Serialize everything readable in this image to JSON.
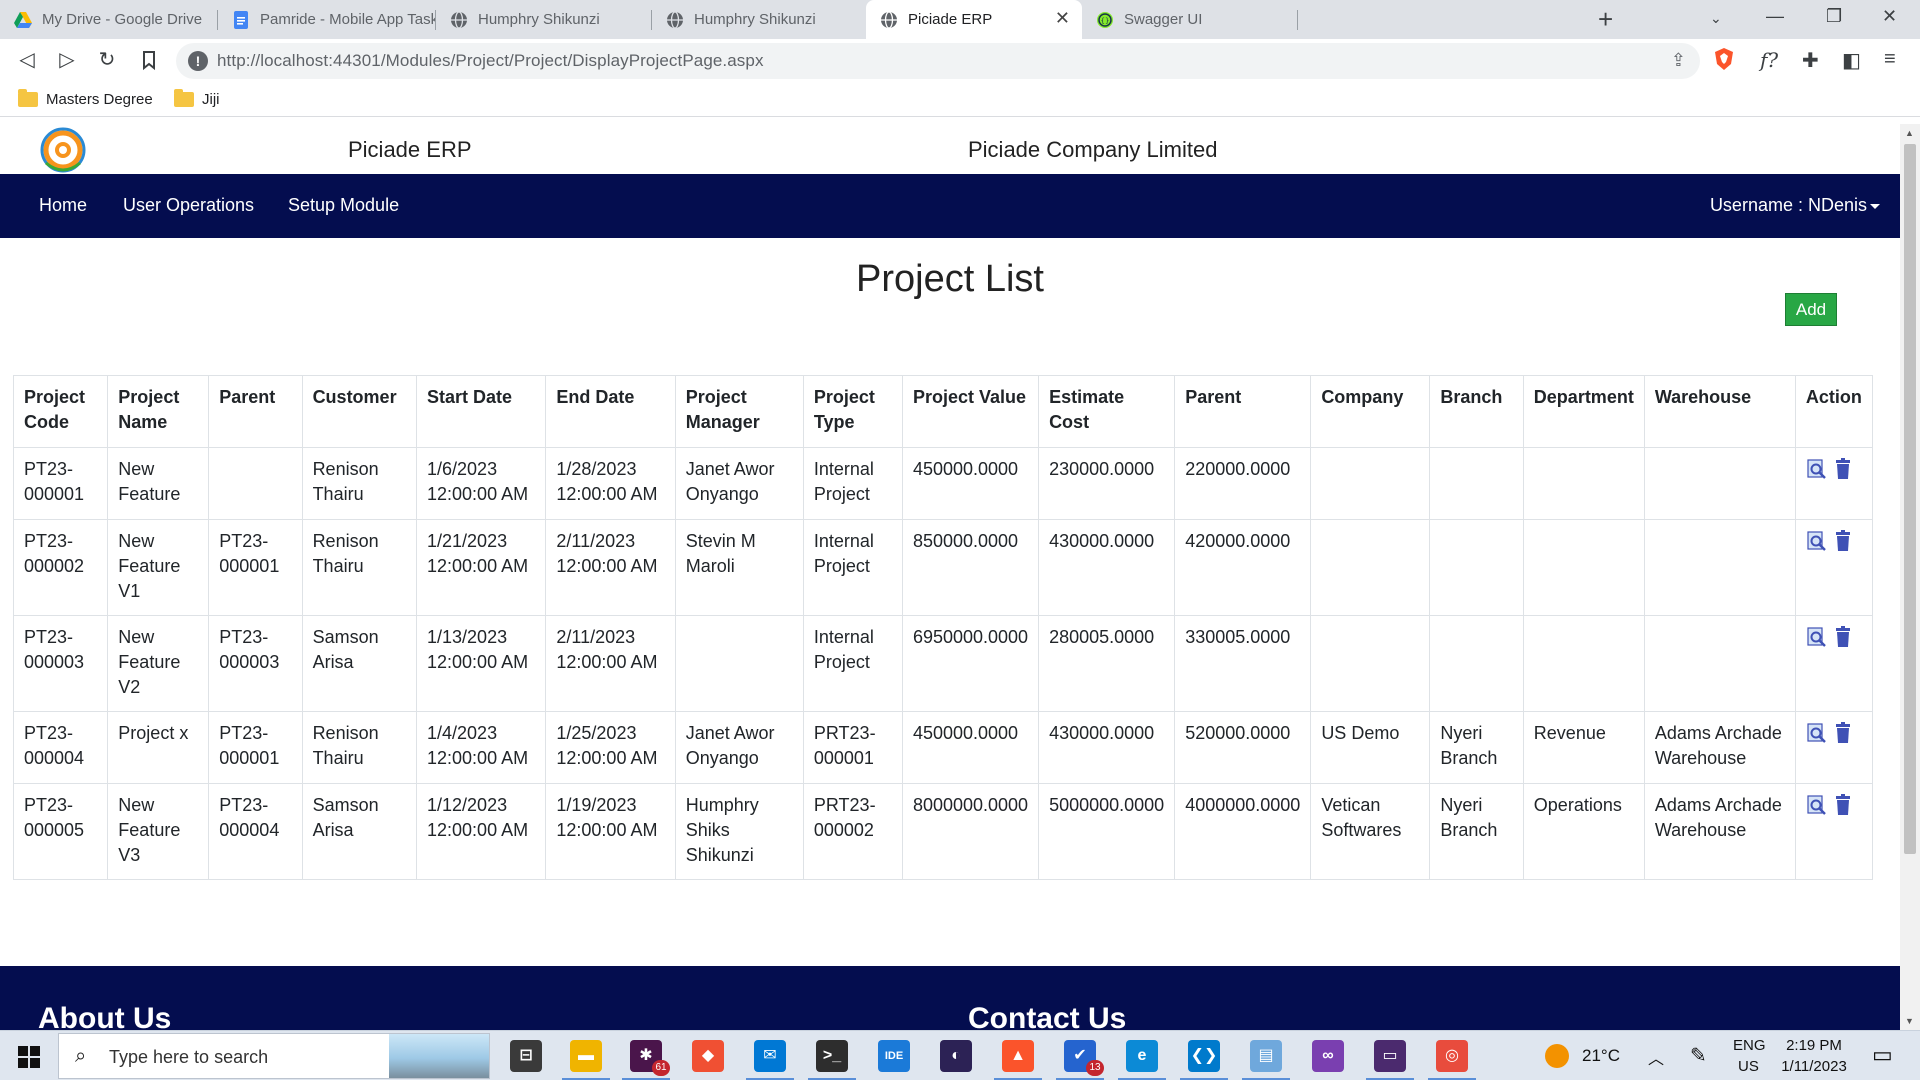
{
  "browser": {
    "tabs": [
      {
        "title": "My Drive - Google Drive",
        "icon": "google-drive-icon",
        "active": false
      },
      {
        "title": "Pamride - Mobile App Tasks - Go",
        "icon": "google-docs-icon",
        "active": false
      },
      {
        "title": "Humphry Shikunzi",
        "icon": "globe-icon",
        "active": false
      },
      {
        "title": "Humphry Shikunzi",
        "icon": "globe-icon",
        "active": false
      },
      {
        "title": "Piciade ERP",
        "icon": "globe-icon",
        "active": true
      },
      {
        "title": "Swagger UI",
        "icon": "swagger-icon",
        "active": false
      }
    ],
    "url": "http://localhost:44301/Modules/Project/Project/DisplayProjectPage.aspx",
    "bookmarks": [
      {
        "label": "Masters Degree",
        "icon": "folder-icon"
      },
      {
        "label": "Jiji",
        "icon": "folder-icon"
      }
    ]
  },
  "header": {
    "brand": "Piciade ERP",
    "company": "Piciade Company Limited"
  },
  "nav": {
    "items": [
      "Home",
      "User Operations",
      "Setup Module"
    ],
    "user": "Username : NDenis"
  },
  "main": {
    "title": "Project List",
    "add_label": "Add",
    "table": {
      "columns": [
        "Project Code",
        "Project Name",
        "Parent",
        "Customer",
        "Start Date",
        "End Date",
        "Project Manager",
        "Project Type",
        "Project Value",
        "Estimate Cost",
        "Parent",
        "Company",
        "Branch",
        "Department",
        "Warehouse",
        "Action"
      ],
      "rows": [
        [
          "PT23-000001",
          "New Feature",
          "",
          "Renison Thairu",
          "1/6/2023 12:00:00 AM",
          "1/28/2023 12:00:00 AM",
          "Janet Awor Onyango",
          "Internal Project",
          "450000.0000",
          "230000.0000",
          "220000.0000",
          "",
          "",
          "",
          ""
        ],
        [
          "PT23-000002",
          "New Feature V1",
          "PT23-000001",
          "Renison Thairu",
          "1/21/2023 12:00:00 AM",
          "2/11/2023 12:00:00 AM",
          "Stevin M Maroli",
          "Internal Project",
          "850000.0000",
          "430000.0000",
          "420000.0000",
          "",
          "",
          "",
          ""
        ],
        [
          "PT23-000003",
          "New Feature V2",
          "PT23-000003",
          "Samson Arisa",
          "1/13/2023 12:00:00 AM",
          "2/11/2023 12:00:00 AM",
          "",
          "Internal Project",
          "6950000.0000",
          "280005.0000",
          "330005.0000",
          "",
          "",
          "",
          ""
        ],
        [
          "PT23-000004",
          "Project x",
          "PT23-000001",
          "Renison Thairu",
          "1/4/2023 12:00:00 AM",
          "1/25/2023 12:00:00 AM",
          "Janet Awor Onyango",
          "PRT23-000001",
          "450000.0000",
          "430000.0000",
          "520000.0000",
          "US Demo",
          "Nyeri Branch",
          "Revenue",
          "Adams Archade Warehouse"
        ],
        [
          "PT23-000005",
          "New Feature V3",
          "PT23-000004",
          "Samson Arisa",
          "1/12/2023 12:00:00 AM",
          "1/19/2023 12:00:00 AM",
          "Humphry Shiks Shikunzi",
          "PRT23-000002",
          "8000000.0000",
          "5000000.0000",
          "4000000.0000",
          "Vetican Softwares",
          "Nyeri Branch",
          "Operations",
          "Adams Archade Warehouse"
        ]
      ],
      "action_icons": [
        "view-icon",
        "delete-icon"
      ]
    }
  },
  "footer": {
    "about": "About Us",
    "contact": "Contact Us"
  },
  "taskbar": {
    "search_placeholder": "Type here to search",
    "apps": [
      {
        "name": "task-view-icon",
        "badge": ""
      },
      {
        "name": "file-explorer-icon",
        "badge": ""
      },
      {
        "name": "slack-icon",
        "badge": "61"
      },
      {
        "name": "git-icon",
        "badge": ""
      },
      {
        "name": "mail-icon",
        "badge": ""
      },
      {
        "name": "terminal-icon",
        "badge": ""
      },
      {
        "name": "intellij-icon",
        "badge": ""
      },
      {
        "name": "eclipse-icon",
        "badge": ""
      },
      {
        "name": "brave-icon",
        "badge": ""
      },
      {
        "name": "todo-icon",
        "badge": "13"
      },
      {
        "name": "edge-icon",
        "badge": ""
      },
      {
        "name": "vscode-icon",
        "badge": ""
      },
      {
        "name": "notepad-icon",
        "badge": ""
      },
      {
        "name": "visual-studio-icon",
        "badge": ""
      },
      {
        "name": "powershell-icon",
        "badge": ""
      },
      {
        "name": "paint-icon",
        "badge": ""
      }
    ],
    "weather": "21°C",
    "lang_top": "ENG",
    "lang_bottom": "US",
    "time": "2:19 PM",
    "date": "1/11/2023"
  },
  "colors": {
    "nav_bg": "#040d4f",
    "add_button": "#28a745",
    "action_icon": "#3f51b5"
  }
}
